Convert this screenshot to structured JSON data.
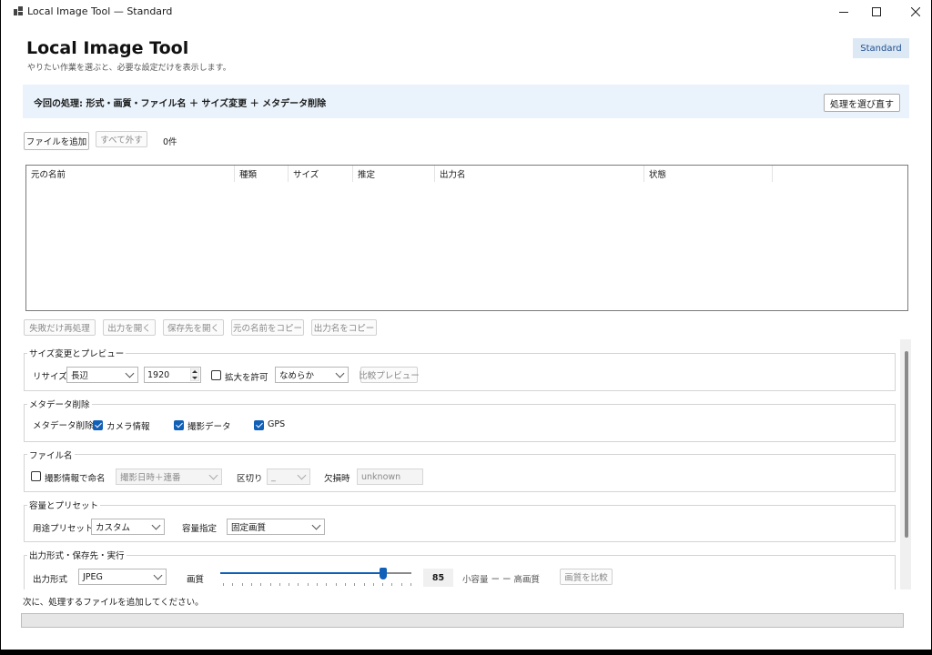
{
  "window": {
    "title": "Local Image Tool — Standard"
  },
  "header": {
    "title": "Local Image Tool",
    "subtitle": "やりたい作業を選ぶと、必要な設定だけを表示します。",
    "mode_badge": "Standard"
  },
  "banner": {
    "text": "今回の処理: 形式・画質・ファイル名 ＋ サイズ変更 ＋ メタデータ削除",
    "reselect_label": "処理を選び直す"
  },
  "file_toolbar": {
    "add_label": "ファイルを追加",
    "remove_all_label": "すべて外す",
    "count": "0件"
  },
  "table": {
    "columns": [
      "元の名前",
      "種類",
      "サイズ",
      "推定",
      "出力名",
      "状態"
    ],
    "rows": []
  },
  "actions": {
    "retry_failed": "失敗だけ再処理",
    "open_output": "出力を開く",
    "open_dest": "保存先を開く",
    "copy_original": "元の名前をコピー",
    "copy_output": "出力名をコピー"
  },
  "resize": {
    "group_label": "サイズ変更とプレビュー",
    "label": "リサイズ",
    "mode": "長辺",
    "size": "1920",
    "allow_upscale_label": "拡大を許可",
    "allow_upscale": false,
    "quality": "なめらか",
    "compare_label": "比較プレビュー"
  },
  "metadata": {
    "group_label": "メタデータ削除",
    "label": "メタデータ削除",
    "camera_label": "カメラ情報",
    "camera": true,
    "shot_label": "撮影データ",
    "shot": true,
    "gps_label": "GPS",
    "gps": true
  },
  "filename": {
    "group_label": "ファイル名",
    "use_exif_label": "撮影情報で命名",
    "use_exif": false,
    "pattern": "撮影日時＋連番",
    "sep_label": "区切り",
    "sep": "_",
    "missing_label": "欠損時",
    "missing_value": "unknown"
  },
  "capacity": {
    "group_label": "容量とプリセット",
    "preset_label": "用途プリセット",
    "preset": "カスタム",
    "size_mode_label": "容量指定",
    "size_mode": "固定画質"
  },
  "output": {
    "group_label": "出力形式・保存先・実行",
    "format_label": "出力形式",
    "format": "JPEG",
    "quality_label": "画質",
    "quality_value": "85",
    "quality_fraction": 0.85,
    "scale_hint": "小容量 ー ー 高画質",
    "compare_label": "画質を比較"
  },
  "status": {
    "message": "次に、処理するファイルを追加してください。",
    "progress": 0
  },
  "colors": {
    "accent": "#1160b7",
    "banner_bg": "#eaf3fc",
    "badge_bg": "#dde8f5"
  }
}
